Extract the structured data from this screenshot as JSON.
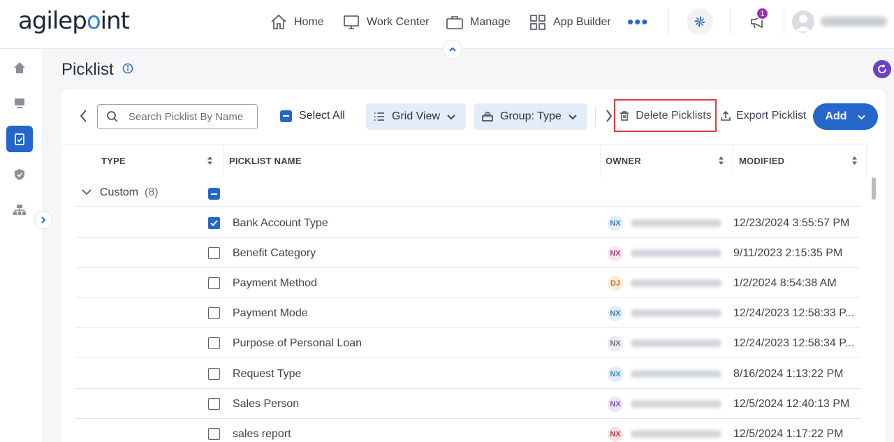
{
  "app": {
    "logo_text_left": "agilep",
    "logo_text_o": "o",
    "logo_text_right": "int"
  },
  "nav": [
    {
      "label": "Home",
      "icon": "home-icon"
    },
    {
      "label": "Work Center",
      "icon": "monitor-icon"
    },
    {
      "label": "Manage",
      "icon": "briefcase-icon"
    },
    {
      "label": "App Builder",
      "icon": "grid-icon"
    }
  ],
  "header": {
    "more_label": "•••",
    "notification_count": "1"
  },
  "page": {
    "title": "Picklist"
  },
  "toolbar": {
    "search_placeholder": "Search Picklist By Name",
    "select_all": "Select All",
    "grid_view": "Grid View",
    "group_type": "Group: Type",
    "delete_picklists": "Delete Picklists",
    "export_picklist": "Export Picklist",
    "add": "Add"
  },
  "table": {
    "columns": {
      "type": "TYPE",
      "name": "PICKLIST NAME",
      "owner": "OWNER",
      "modified": "MODIFIED"
    },
    "group": {
      "label": "Custom",
      "count": "(8)"
    },
    "rows": [
      {
        "name": "Bank Account Type",
        "initials": "NX",
        "modified": "12/23/2024 3:55:57 PM",
        "checked": true
      },
      {
        "name": "Benefit Category",
        "initials": "NX",
        "modified": "9/11/2023 2:15:35 PM",
        "checked": false
      },
      {
        "name": "Payment Method",
        "initials": "DJ",
        "modified": "1/2/2024 8:54:38 AM",
        "checked": false
      },
      {
        "name": "Payment Mode",
        "initials": "NX",
        "modified": "12/24/2023 12:58:33 P...",
        "checked": false
      },
      {
        "name": "Purpose of Personal Loan",
        "initials": "NX",
        "modified": "12/24/2023 12:58:34 P...",
        "checked": false
      },
      {
        "name": "Request Type",
        "initials": "NX",
        "modified": "8/16/2024 1:13:22 PM",
        "checked": false
      },
      {
        "name": "Sales Person",
        "initials": "NX",
        "modified": "12/5/2024 12:40:13 PM",
        "checked": false
      },
      {
        "name": "sales report",
        "initials": "NX",
        "modified": "12/5/2024 1:17:22 PM",
        "checked": false
      }
    ]
  },
  "colors": {
    "accent": "#2466c9",
    "badge": "#9b2fae",
    "highlight": "#e03a3a",
    "initials": [
      "#e2eef8",
      "#f8e4f0",
      "#fbecd9",
      "#e2eef8",
      "#ececee",
      "#e2eef8",
      "#ece6f6",
      "#f9e2e2"
    ],
    "initials_text": [
      "#4a78a8",
      "#b0357f",
      "#b07a2f",
      "#4a78a8",
      "#6b717b",
      "#3a8ad8",
      "#7a55b9",
      "#c23b3b"
    ]
  }
}
